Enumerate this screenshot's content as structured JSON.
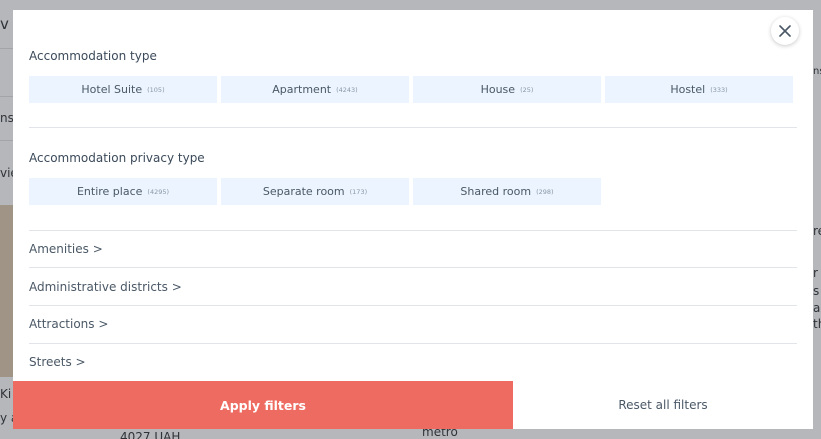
{
  "background": {
    "fragments": [
      "v",
      "nsi",
      "vie",
      "Ki",
      "y a",
      "re",
      "r c",
      "s",
      "a",
      "th",
      "4027 UAH",
      "metro",
      "ns"
    ]
  },
  "modal": {
    "sections": [
      {
        "title": "Accommodation type",
        "options": [
          {
            "label": "Hotel Suite",
            "count": "(105)"
          },
          {
            "label": "Apartment",
            "count": "(4243)"
          },
          {
            "label": "House",
            "count": "(25)"
          },
          {
            "label": "Hostel",
            "count": "(333)"
          }
        ]
      },
      {
        "title": "Accommodation privacy type",
        "options": [
          {
            "label": "Entire place",
            "count": "(4295)"
          },
          {
            "label": "Separate room",
            "count": "(173)"
          },
          {
            "label": "Shared room",
            "count": "(298)"
          }
        ]
      }
    ],
    "expanders": [
      "Amenities >",
      "Administrative districts >",
      "Attractions >",
      "Streets >"
    ],
    "apply_label": "Apply filters",
    "reset_label": "Reset all filters"
  },
  "colors": {
    "apply": "#ee6b62",
    "chip_bg": "#ebf4ff",
    "overlay": "#b5b7bb"
  },
  "icons": {
    "close": "close-icon"
  }
}
